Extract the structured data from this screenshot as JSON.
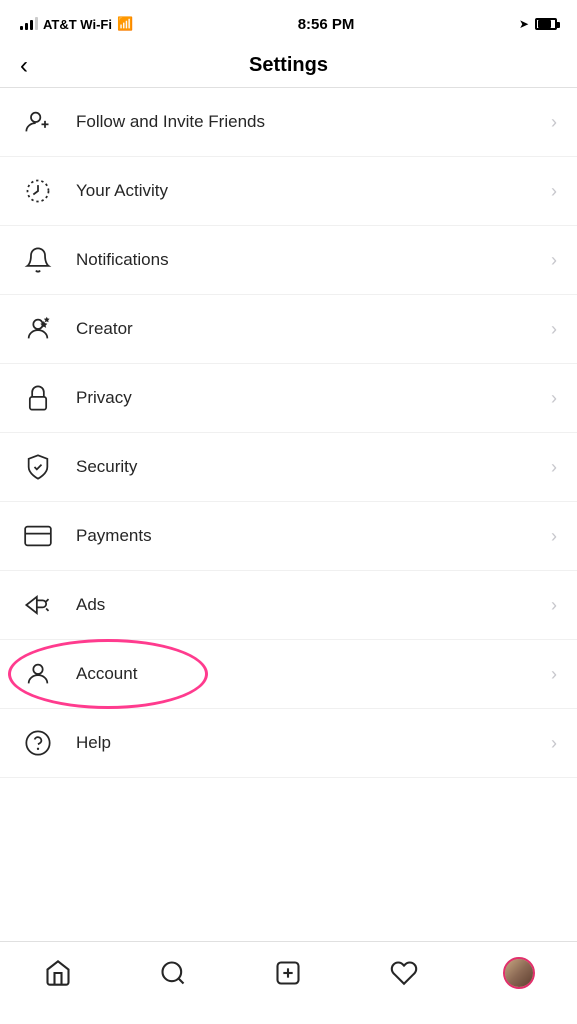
{
  "statusBar": {
    "carrier": "AT&T Wi-Fi",
    "time": "8:56 PM",
    "battery": "75"
  },
  "header": {
    "title": "Settings",
    "backLabel": "<"
  },
  "menuItems": [
    {
      "id": "follow-invite",
      "label": "Follow and Invite Friends",
      "icon": "person-add-icon"
    },
    {
      "id": "your-activity",
      "label": "Your Activity",
      "icon": "activity-icon"
    },
    {
      "id": "notifications",
      "label": "Notifications",
      "icon": "bell-icon"
    },
    {
      "id": "creator",
      "label": "Creator",
      "icon": "creator-icon"
    },
    {
      "id": "privacy",
      "label": "Privacy",
      "icon": "lock-icon"
    },
    {
      "id": "security",
      "label": "Security",
      "icon": "shield-icon"
    },
    {
      "id": "payments",
      "label": "Payments",
      "icon": "card-icon"
    },
    {
      "id": "ads",
      "label": "Ads",
      "icon": "ads-icon"
    },
    {
      "id": "account",
      "label": "Account",
      "icon": "person-icon",
      "highlighted": true
    },
    {
      "id": "help",
      "label": "Help",
      "icon": "help-icon"
    }
  ],
  "bottomNav": {
    "items": [
      "home",
      "search",
      "add",
      "heart",
      "profile"
    ]
  }
}
